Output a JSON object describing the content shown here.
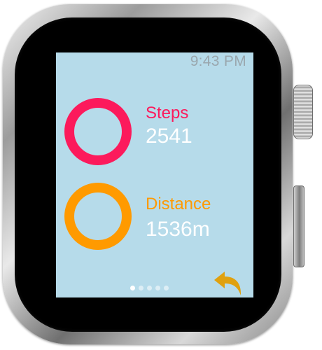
{
  "status_bar": {
    "time": "9:43 PM"
  },
  "metrics": [
    {
      "label": "Steps",
      "value": "2541",
      "color": "#fc1a5c",
      "icon": "progress-ring-icon"
    },
    {
      "label": "Distance",
      "value": "1536m",
      "color": "#ff9a00",
      "icon": "progress-ring-icon"
    }
  ],
  "pagination": {
    "total_pages": 5,
    "current_page": 1
  },
  "back_button": {
    "icon": "reply-arrow-icon",
    "color": "#e0a10f"
  },
  "colors": {
    "screen_background": "#b6dbea",
    "value_text": "#ffffff",
    "status_text": "#9aa7ae"
  }
}
